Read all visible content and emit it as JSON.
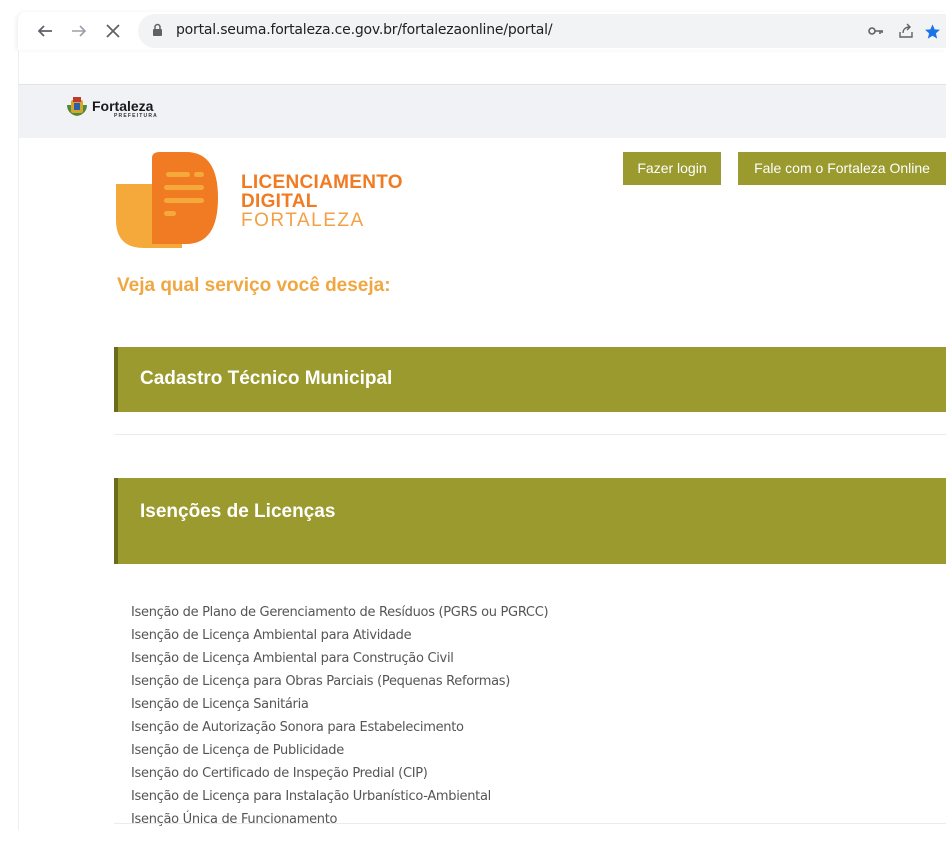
{
  "browser": {
    "url": "portal.seuma.fortaleza.ce.gov.br/fortalezaonline/portal/"
  },
  "header": {
    "brand_name": "Fortaleza",
    "brand_sub": "PREFEITURA"
  },
  "logo": {
    "line1": "LICENCIAMENTO",
    "line2": "DIGITAL",
    "line3": "FORTALEZA"
  },
  "actions": {
    "login_label": "Fazer login",
    "contact_label": "Fale com o Fortaleza Online"
  },
  "main": {
    "prompt": "Veja qual serviço você deseja:",
    "sections": [
      {
        "title": "Cadastro Técnico Municipal"
      },
      {
        "title": "Isenções de Licenças"
      }
    ],
    "isencoes": [
      "Isenção de Plano de Gerenciamento de Resíduos (PGRS ou PGRCC)",
      "Isenção de Licença Ambiental para Atividade",
      "Isenção de Licença Ambiental para Construção Civil",
      "Isenção de Licença para Obras Parciais (Pequenas Reformas)",
      "Isenção de Licença Sanitária",
      "Isenção de Autorização Sonora para Estabelecimento",
      "Isenção de Licença de Publicidade",
      "Isenção do Certificado de Inspeção Predial (CIP)",
      "Isenção de Licença para Instalação Urbanístico-Ambiental",
      "Isenção Única de Funcionamento"
    ]
  },
  "colors": {
    "accent_olive": "#9a9a2e",
    "accent_orange": "#f07b23",
    "prompt_orange": "#f0a742"
  }
}
